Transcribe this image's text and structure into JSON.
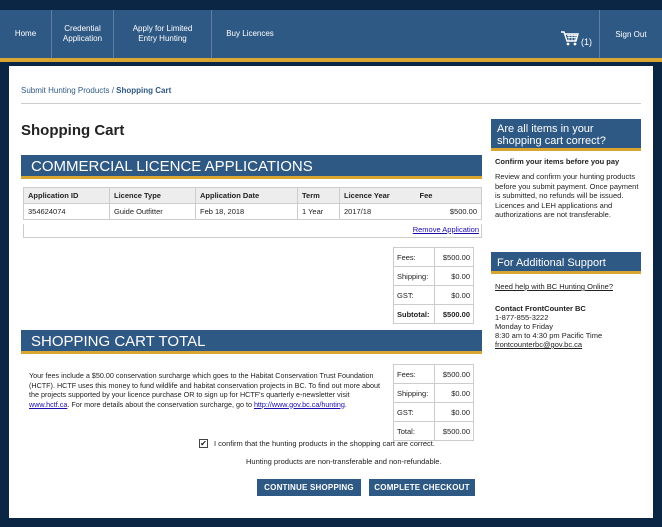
{
  "nav": {
    "items": [
      {
        "label": "Home"
      },
      {
        "line1": "Credential",
        "line2": "Application"
      },
      {
        "line1": "Apply for Limited",
        "line2": "Entry Hunting"
      },
      {
        "label": "Buy Licences"
      }
    ],
    "cart_count": "(1)",
    "sign_out": "Sign Out"
  },
  "breadcrumb": {
    "parent": "Submit Hunting Products",
    "separator": " / ",
    "current": "Shopping Cart"
  },
  "page_title": "Shopping Cart",
  "applications": {
    "heading": "COMMERCIAL LICENCE APPLICATIONS",
    "columns": [
      "Application ID",
      "Licence Type",
      "Application Date",
      "Term",
      "Licence Year",
      "Fee"
    ],
    "rows": [
      [
        "354624074",
        "Guide Outfitter",
        "Feb 18, 2018",
        "1 Year",
        "2017/18",
        "$500.00"
      ]
    ],
    "remove_label": "Remove Application",
    "totals": [
      {
        "label": "Fees:",
        "value": "$500.00"
      },
      {
        "label": "Shipping:",
        "value": "$0.00"
      },
      {
        "label": "GST:",
        "value": "$0.00"
      },
      {
        "label": "Subtotal:",
        "value": "$500.00"
      }
    ]
  },
  "cart_total": {
    "heading": "SHOPPING CART TOTAL",
    "text_1": "Your fees include a $50.00 conservation surcharge which goes to the Habitat Conservation Trust Foundation (HCTF). HCTF uses this money to fund wildlife and habitat conservation projects in BC. To find out more about the projects supported by your licence purchase OR to sign up for HCTF's quarterly e-newsletter visit ",
    "link_1": "www.hctf.ca",
    "text_2": ". For more details about the conservation surcharge, go to ",
    "link_2": "http://www.gov.bc.ca/hunting",
    "text_3": ".",
    "totals": [
      {
        "label": "Fees:",
        "value": "$500.00"
      },
      {
        "label": "Shipping:",
        "value": "$0.00"
      },
      {
        "label": "GST:",
        "value": "$0.00"
      },
      {
        "label": "Total:",
        "value": "$500.00"
      }
    ],
    "confirm_label": "I confirm that the hunting products in the shopping cart are correct.",
    "confirm_checked": true,
    "nontransfer": "Hunting products are non-transferable and non-refundable.",
    "continue_label": "CONTINUE SHOPPING",
    "checkout_label": "COMPLETE CHECKOUT"
  },
  "sidebar": {
    "confirm_heading": "Are all items in your shopping cart correct?",
    "confirm_sub": "Confirm your items before you pay",
    "confirm_text": "Review and confirm your hunting products before you submit payment. Once payment is submitted, no refunds will be issued. Licences and LEH applications and authorizations are not transferable.",
    "support_heading": "For Additional Support",
    "help_link": "Need help with BC Hunting Online?",
    "contact_name": "Contact FrontCounter BC",
    "phone": "1-877-855-3222",
    "days": "Monday to Friday",
    "hours": "8:30 am to 4:30 pm Pacific Time",
    "email": "frontcounterbc@gov.bc.ca"
  },
  "colors": {
    "header": "#2f5985",
    "accent": "#d9a531",
    "background": "#0b2545"
  }
}
